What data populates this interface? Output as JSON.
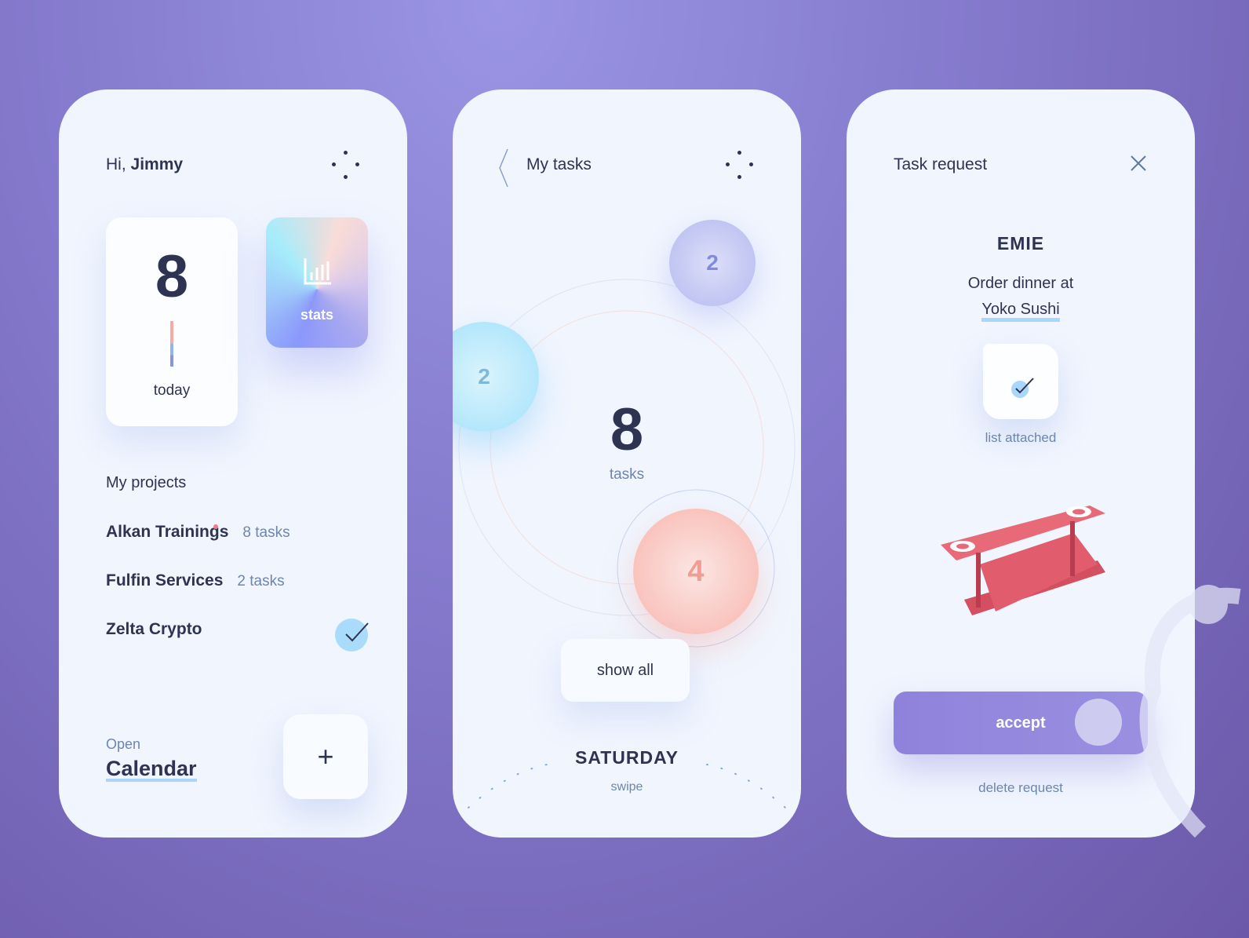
{
  "home": {
    "greeting": "Hi,",
    "user": "Jimmy",
    "today_count": "8",
    "today_label": "today",
    "stats_label": "stats",
    "projects_title": "My projects",
    "projects": [
      {
        "name": "Alkan Trainings",
        "tasks": "8 tasks",
        "badge": true
      },
      {
        "name": "Fulfin Services",
        "tasks": "2 tasks"
      },
      {
        "name": "Zelta Crypto",
        "done": true
      }
    ],
    "open_label": "Open",
    "calendar_label": "Calendar",
    "add_icon": "plus-icon"
  },
  "tasks": {
    "title": "My tasks",
    "total": "8",
    "total_label": "tasks",
    "bubbles": [
      "2",
      "2",
      "4"
    ],
    "show_all": "show all",
    "day": "SATURDAY",
    "swipe": "swipe"
  },
  "request": {
    "title": "Task request",
    "from": "EMIE",
    "text_line1": "Order dinner at",
    "text_line2": "Yoko Sushi",
    "attachment": "list attached",
    "accept": "accept",
    "delete": "delete request"
  },
  "colors": {
    "accent": "#8f82dc",
    "dark": "#2f3352",
    "muted": "#6e86ad",
    "highlight": "#a9d6fb",
    "coral": "#f7a9a3"
  }
}
